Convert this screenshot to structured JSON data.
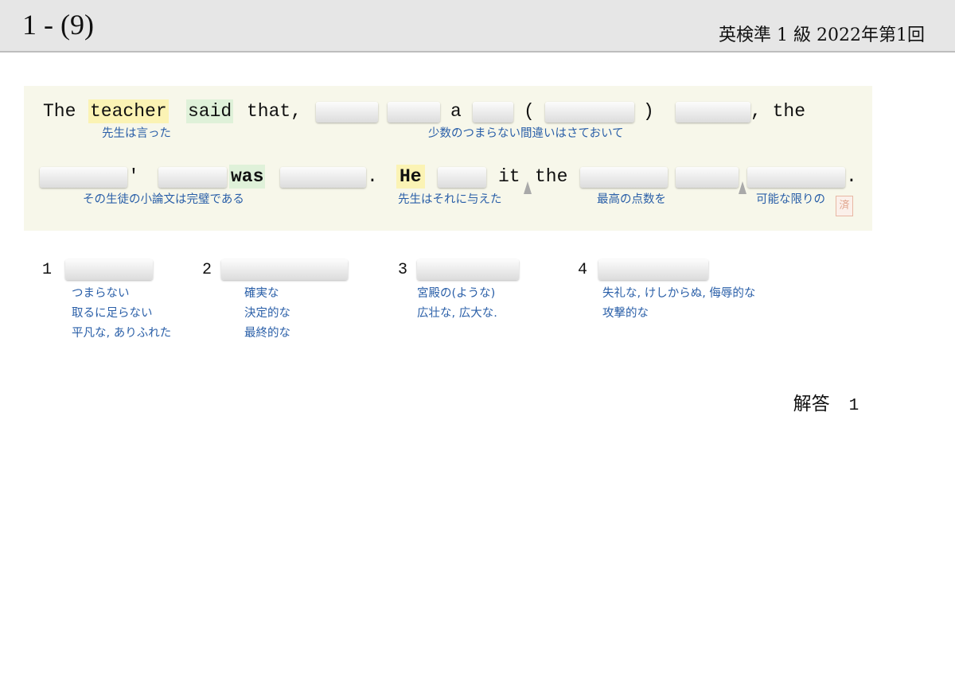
{
  "header": {
    "question_number": "1 - (9)",
    "exam_label": "英検準 1 級  2022年第1回"
  },
  "sentence": {
    "line1": {
      "w_the": "The",
      "w_teacher": "teacher",
      "w_said": "said",
      "w_that": "that,",
      "w_a": "a",
      "w_lparen": "(",
      "w_rparen": ")",
      "w_comma_the": ", the"
    },
    "line2": {
      "w_apos": "'",
      "w_was": "was",
      "w_period1": ".",
      "w_he": "He",
      "w_it": "it",
      "w_the": "the",
      "w_period2": "."
    }
  },
  "glosses": {
    "teacher_said": "先生は言った",
    "minor_errors": "少数のつまらない間違いはさておいて",
    "essay_perfect": "その生徒の小論文は完璧である",
    "he_gave": "先生はそれに与えた",
    "highest_score": "最高の点数を",
    "as_possible": "可能な限りの"
  },
  "seal_text": "済",
  "options": [
    {
      "number": "1",
      "meanings": [
        "つまらない",
        "取るに足らない",
        "平凡な, ありふれた"
      ]
    },
    {
      "number": "2",
      "meanings": [
        "確実な",
        "決定的な",
        "最終的な"
      ]
    },
    {
      "number": "3",
      "meanings": [
        "宮殿の(ような)",
        "広壮な, 広大な."
      ]
    },
    {
      "number": "4",
      "meanings": [
        "失礼な, けしからぬ, 侮辱的な",
        "攻撃的な"
      ]
    }
  ],
  "answer": {
    "label": "解答",
    "value": "1"
  }
}
